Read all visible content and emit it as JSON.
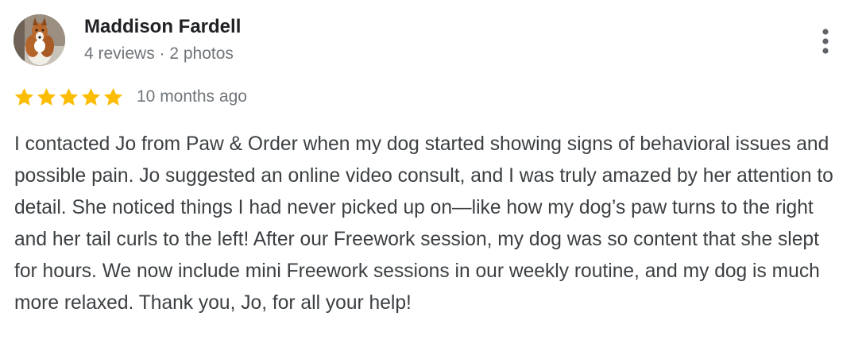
{
  "review": {
    "author": {
      "name": "Maddison Fardell",
      "meta": "4 reviews · 2 photos",
      "avatar_icon": "dog-avatar"
    },
    "more_icon": "more-vert-icon",
    "rating": {
      "value": 5,
      "max": 5,
      "star_color": "#fbbc04"
    },
    "time_ago": "10 months ago",
    "text": "I contacted Jo from Paw & Order when my dog started showing signs of behavioral issues and possible pain. Jo suggested an online video consult, and I was truly amazed by her attention to detail. She noticed things I had never picked up on—like how my dog’s paw turns to the right and her tail curls to the left! After our Freework session, my dog was so content that she slept for hours. We now include mini Freework sessions in our weekly routine, and my dog is much more relaxed. Thank you, Jo, for all your help!"
  }
}
